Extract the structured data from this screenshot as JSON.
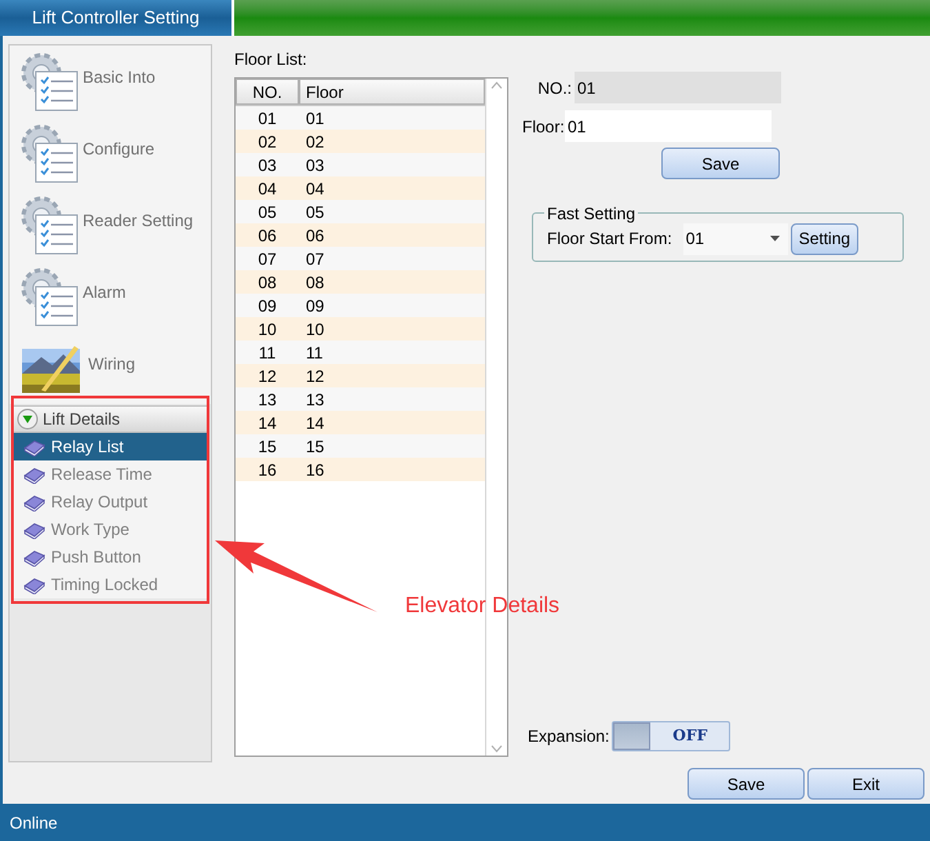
{
  "window": {
    "title": "Lift Controller Setting"
  },
  "sidebar": {
    "items": [
      {
        "label": "Basic Into",
        "kind": "gear"
      },
      {
        "label": "Configure",
        "kind": "gear"
      },
      {
        "label": "Reader Setting",
        "kind": "gear"
      },
      {
        "label": "Alarm",
        "kind": "gear"
      },
      {
        "label": "Wiring",
        "kind": "picture"
      }
    ],
    "group": {
      "label": "Lift Details",
      "expanded": true,
      "items": [
        {
          "label": "Relay List",
          "selected": true
        },
        {
          "label": "Release Time",
          "selected": false
        },
        {
          "label": "Relay Output",
          "selected": false
        },
        {
          "label": "Work Type",
          "selected": false
        },
        {
          "label": "Push Button",
          "selected": false
        },
        {
          "label": "Timing Locked",
          "selected": false
        }
      ]
    }
  },
  "floor_list": {
    "label": "Floor List:",
    "columns": [
      "NO.",
      "Floor"
    ],
    "rows": [
      [
        "01",
        "01"
      ],
      [
        "02",
        "02"
      ],
      [
        "03",
        "03"
      ],
      [
        "04",
        "04"
      ],
      [
        "05",
        "05"
      ],
      [
        "06",
        "06"
      ],
      [
        "07",
        "07"
      ],
      [
        "08",
        "08"
      ],
      [
        "09",
        "09"
      ],
      [
        "10",
        "10"
      ],
      [
        "11",
        "11"
      ],
      [
        "12",
        "12"
      ],
      [
        "13",
        "13"
      ],
      [
        "14",
        "14"
      ],
      [
        "15",
        "15"
      ],
      [
        "16",
        "16"
      ]
    ]
  },
  "form": {
    "no_label": "NO.:",
    "no_value": "01",
    "floor_label": "Floor:",
    "floor_value": "01",
    "save": "Save"
  },
  "fast_setting": {
    "title": "Fast Setting",
    "label": "Floor Start From:",
    "value": "01",
    "button": "Setting"
  },
  "expansion": {
    "label": "Expansion:",
    "on": false,
    "off_text": "OFF"
  },
  "buttons": [
    "Save",
    "Exit"
  ],
  "status_bar": "Online",
  "annotation": {
    "text": "Elevator Details"
  }
}
